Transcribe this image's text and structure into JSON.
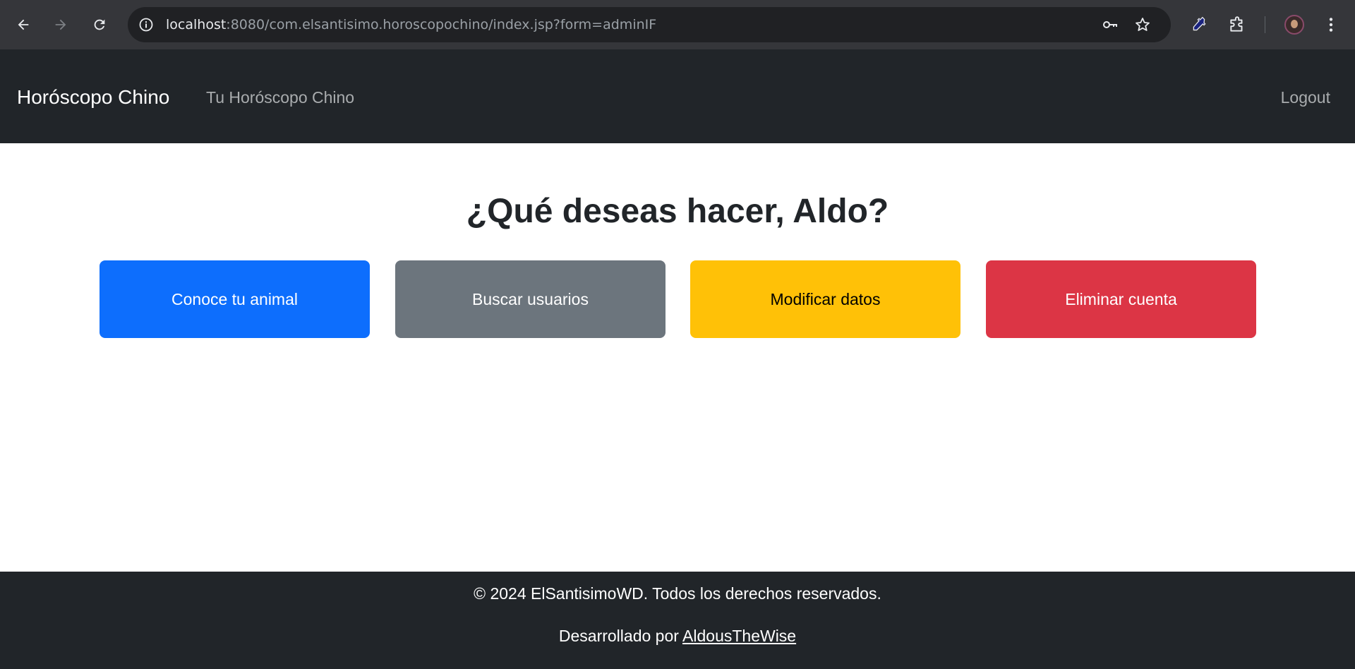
{
  "browser": {
    "url_host": "localhost",
    "url_path": ":8080/com.elsantisimo.horoscopochino/index.jsp?form=adminIF",
    "icons": [
      "back-arrow-icon",
      "forward-arrow-icon",
      "reload-icon",
      "info-icon",
      "key-icon",
      "star-icon",
      "eyedropper-icon",
      "extensions-icon",
      "profile-avatar",
      "more-vert-icon"
    ]
  },
  "navbar": {
    "brand": "Horóscopo Chino",
    "link": "Tu Horóscopo Chino",
    "logout": "Logout"
  },
  "main": {
    "title": "¿Qué deseas hacer, Aldo?",
    "buttons": [
      {
        "label": "Conoce tu animal",
        "color": "#0d6efd"
      },
      {
        "label": "Buscar usuarios",
        "color": "#6c757d"
      },
      {
        "label": "Modificar datos",
        "color": "#ffc107"
      },
      {
        "label": "Eliminar cuenta",
        "color": "#dc3545"
      }
    ]
  },
  "footer": {
    "copyright": "© 2024 ElSantisimoWD. Todos los derechos reservados.",
    "developed_by": "Desarrollado por ",
    "author_link": "AldousTheWise"
  }
}
